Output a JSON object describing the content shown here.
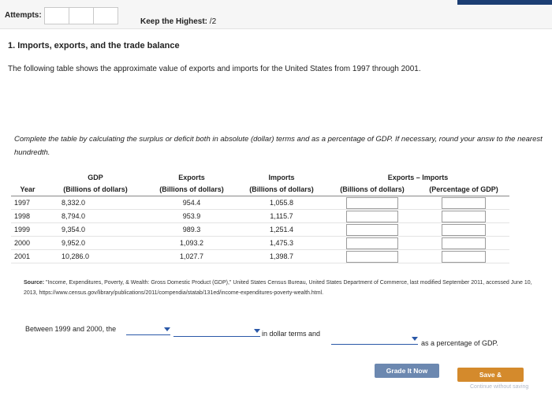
{
  "header": {
    "attempts_label": "Attempts:",
    "keep_label": "Keep the Highest:",
    "keep_value": "/2"
  },
  "question": {
    "title": "1. Imports, exports, and the trade balance",
    "intro": "The following table shows the approximate value of exports and imports for the United States from 1997 through 2001.",
    "instructions": "Complete the table by calculating the surplus or deficit both in absolute (dollar) terms and as a percentage of GDP. If necessary, round your answ to the nearest hundredth."
  },
  "table": {
    "header_year": "Year",
    "header_gdp": "GDP",
    "header_gdp_units": "(Billions of dollars)",
    "header_exports": "Exports",
    "header_exports_units": "(Billions of dollars)",
    "header_imports": "Imports",
    "header_imports_units": "(Billions of dollars)",
    "header_diff": "Exports – Imports",
    "header_diff_abs": "(Billions of dollars)",
    "header_diff_pct": "(Percentage of GDP)",
    "rows": [
      {
        "year": "1997",
        "gdp": "8,332.0",
        "exports": "954.4",
        "imports": "1,055.8"
      },
      {
        "year": "1998",
        "gdp": "8,794.0",
        "exports": "953.9",
        "imports": "1,115.7"
      },
      {
        "year": "1999",
        "gdp": "9,354.0",
        "exports": "989.3",
        "imports": "1,251.4"
      },
      {
        "year": "2000",
        "gdp": "9,952.0",
        "exports": "1,093.2",
        "imports": "1,475.3"
      },
      {
        "year": "2001",
        "gdp": "10,286.0",
        "exports": "1,027.7",
        "imports": "1,398.7"
      }
    ]
  },
  "source": {
    "label": "Source:",
    "text": "\"Income, Expenditures, Poverty, & Wealth: Gross Domestic Product (GDP),\" United States Census Bureau, United States Department of Commerce, last modified September 2011, accessed June 10, 2013, https://www.census.gov/library/publications/2011/compendia/statab/131ed/income-expenditures-poverty-wealth.html."
  },
  "sentence": {
    "part1": "Between 1999 and 2000, the",
    "part2": "in dollar terms and",
    "part3": "as a percentage of GDP."
  },
  "buttons": {
    "grade": "Grade It Now",
    "save": "Save & Continue",
    "continue": "Continue without saving"
  },
  "colors": {
    "grade_button": "#6c88b0",
    "save_button": "#d48a2c",
    "dropdown_accent": "#2a58a8"
  }
}
